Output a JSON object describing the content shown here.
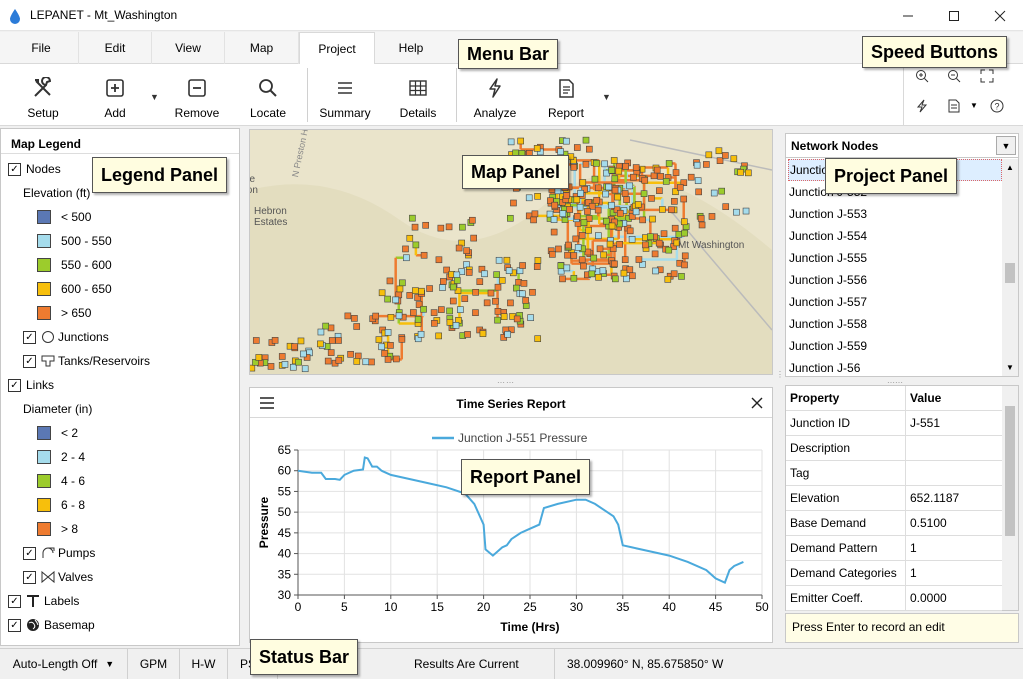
{
  "window": {
    "title": "LEPANET - Mt_Washington"
  },
  "menu": {
    "tabs": [
      "File",
      "Edit",
      "View",
      "Map",
      "Project",
      "Help"
    ],
    "active": "Project"
  },
  "toolbar": {
    "setup": "Setup",
    "add": "Add",
    "remove": "Remove",
    "locate": "Locate",
    "summary": "Summary",
    "details": "Details",
    "analyze": "Analyze",
    "report": "Report"
  },
  "callouts": {
    "menu_bar": "Menu Bar",
    "speed_buttons": "Speed Buttons",
    "legend_panel": "Legend Panel",
    "map_panel": "Map Panel",
    "project_panel": "Project Panel",
    "report_panel": "Report Panel",
    "status_bar": "Status Bar"
  },
  "legend": {
    "title": "Map Legend",
    "nodes": "Nodes",
    "elevation_label": "Elevation (ft)",
    "elevation_bins": [
      {
        "label": "< 500",
        "color": "#5b78b4"
      },
      {
        "label": "500 - 550",
        "color": "#a5dcec"
      },
      {
        "label": "550 - 600",
        "color": "#9ccc2c"
      },
      {
        "label": "600 - 650",
        "color": "#f7bf0c"
      },
      {
        "label": "> 650",
        "color": "#ee7b30"
      }
    ],
    "junctions": "Junctions",
    "tanks": "Tanks/Reservoirs",
    "links": "Links",
    "diameter_label": "Diameter (in)",
    "diameter_bins": [
      {
        "label": "< 2",
        "color": "#5b78b4"
      },
      {
        "label": "2 - 4",
        "color": "#a5dcec"
      },
      {
        "label": "4 - 6",
        "color": "#9ccc2c"
      },
      {
        "label": "6 - 8",
        "color": "#f7bf0c"
      },
      {
        "label": "> 8",
        "color": "#ee7b30"
      }
    ],
    "pumps": "Pumps",
    "valves": "Valves",
    "labels": "Labels",
    "basemap": "Basemap"
  },
  "map": {
    "labels": [
      "N Preston H",
      "Hebron",
      "Estates",
      "Mt Washington",
      "ge",
      "ton"
    ]
  },
  "report": {
    "title": "Time Series Report",
    "chart_data": {
      "type": "line",
      "title": "",
      "xlabel": "Time (Hrs)",
      "ylabel": "Pressure",
      "xlim": [
        0,
        50
      ],
      "ylim": [
        30,
        65
      ],
      "xticks": [
        0,
        5,
        10,
        15,
        20,
        25,
        30,
        35,
        40,
        45,
        50
      ],
      "yticks": [
        30,
        35,
        40,
        45,
        50,
        55,
        60,
        65
      ],
      "series": [
        {
          "name": "Junction J-551 Pressure",
          "color": "#4aa9dc",
          "x": [
            0,
            1.5,
            2.5,
            3,
            4,
            4.5,
            5,
            6,
            7,
            7.2,
            7.5,
            8,
            8.5,
            9,
            10,
            12,
            14,
            16,
            18,
            19,
            20,
            20.2,
            21,
            22,
            22.5,
            23,
            24,
            25,
            26,
            26.5,
            28,
            30,
            31,
            32,
            33,
            34,
            34.5,
            35,
            36,
            38,
            40,
            42,
            44,
            45,
            46,
            46.5,
            47,
            48
          ],
          "y": [
            60,
            59.5,
            59.5,
            58,
            58,
            57.8,
            59,
            60,
            60.3,
            63.2,
            63,
            61,
            61,
            60,
            59,
            58,
            57,
            56,
            54.5,
            52,
            47,
            41,
            39.5,
            41.5,
            42,
            43.5,
            45,
            46,
            47,
            51,
            52,
            53,
            53,
            52,
            50.5,
            49,
            47,
            42,
            41.5,
            40.5,
            39.5,
            38,
            36,
            34,
            33,
            36,
            37,
            38
          ]
        }
      ]
    }
  },
  "nodes_panel": {
    "title": "Network Nodes",
    "items": [
      "Junction J-551",
      "Junction J-552",
      "Junction J-553",
      "Junction J-554",
      "Junction J-555",
      "Junction J-556",
      "Junction J-557",
      "Junction J-558",
      "Junction J-559",
      "Junction J-56"
    ]
  },
  "properties": {
    "header_property": "Property",
    "header_value": "Value",
    "rows": [
      {
        "k": "Junction ID",
        "v": "J-551"
      },
      {
        "k": "Description",
        "v": ""
      },
      {
        "k": "Tag",
        "v": ""
      },
      {
        "k": "Elevation",
        "v": "652.1187"
      },
      {
        "k": "Base Demand",
        "v": "0.5100"
      },
      {
        "k": "Demand Pattern",
        "v": "1"
      },
      {
        "k": "Demand Categories",
        "v": "1"
      },
      {
        "k": "Emitter Coeff.",
        "v": "0.0000"
      }
    ],
    "hint": "Press Enter to record an edit"
  },
  "status": {
    "auto_length": "Auto-Length Off",
    "flow_units": "GPM",
    "headloss": "H-W",
    "pressure": "PSI",
    "results": "Results Are Current",
    "coords": "38.009960° N,  85.675850° W"
  }
}
